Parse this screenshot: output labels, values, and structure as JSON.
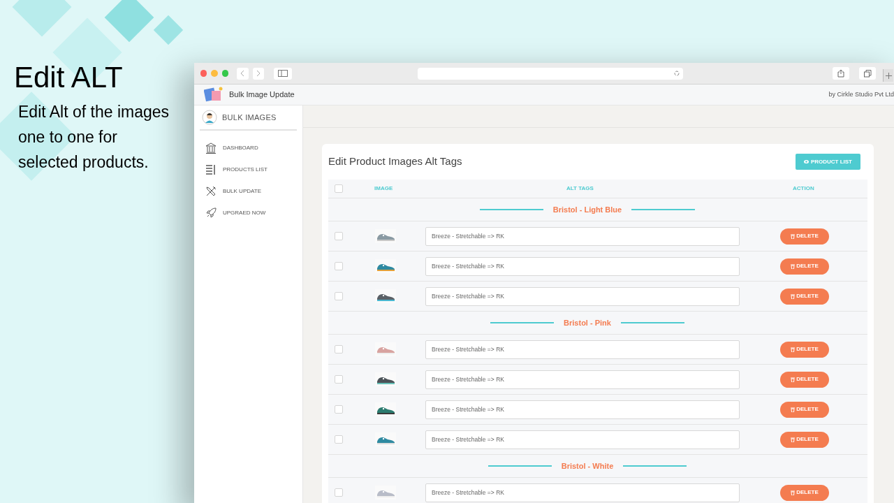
{
  "promo": {
    "title": "Edit ALT",
    "description": "Edit Alt of the images one to one for selected products."
  },
  "app_header": {
    "title": "Bulk Image Update",
    "credit": "by Cirkle Studio Pvt Ltd"
  },
  "sidebar": {
    "brand": "BULK IMAGES",
    "items": [
      {
        "label": "DASHBOARD"
      },
      {
        "label": "PRODUCTS LIST"
      },
      {
        "label": "BULK UPDATE"
      },
      {
        "label": "UPGRAED NOW"
      }
    ]
  },
  "card": {
    "title": "Edit Product Images Alt Tags",
    "button": "PRODUCT LIST",
    "select_all_checked": false,
    "columns": [
      "IMAGE",
      "ALT TAGS",
      "ACTION"
    ],
    "groups": [
      {
        "name": "Bristol - Light Blue",
        "rows": [
          {
            "checked": false,
            "alt": "Breeze - Stretchable => RK",
            "action": "DELETE",
            "kind": "picture"
          },
          {
            "checked": false,
            "alt": "Breeze - Stretchable => RK",
            "action": "DELETE",
            "kind": "picture"
          },
          {
            "checked": false,
            "alt": "Breeze - Stretchable => RK",
            "action": "DELETE",
            "kind": "picture"
          }
        ]
      },
      {
        "name": "Bristol - Pink",
        "rows": [
          {
            "checked": false,
            "alt": "Breeze - Stretchable => RK",
            "action": "DELETE",
            "kind": "picture"
          },
          {
            "checked": false,
            "alt": "Breeze - Stretchable => RK",
            "action": "DELETE",
            "kind": "picture"
          },
          {
            "checked": false,
            "alt": "Breeze - Stretchable => RK",
            "action": "DELETE",
            "kind": "picture"
          },
          {
            "checked": false,
            "alt": "Breeze - Stretchable => RK",
            "action": "DELETE",
            "kind": "picture"
          }
        ]
      },
      {
        "name": "Bristol - White",
        "rows": [
          {
            "checked": false,
            "alt": "Breeze - Stretchable => RK",
            "action": "DELETE",
            "kind": "picture"
          }
        ]
      }
    ]
  }
}
